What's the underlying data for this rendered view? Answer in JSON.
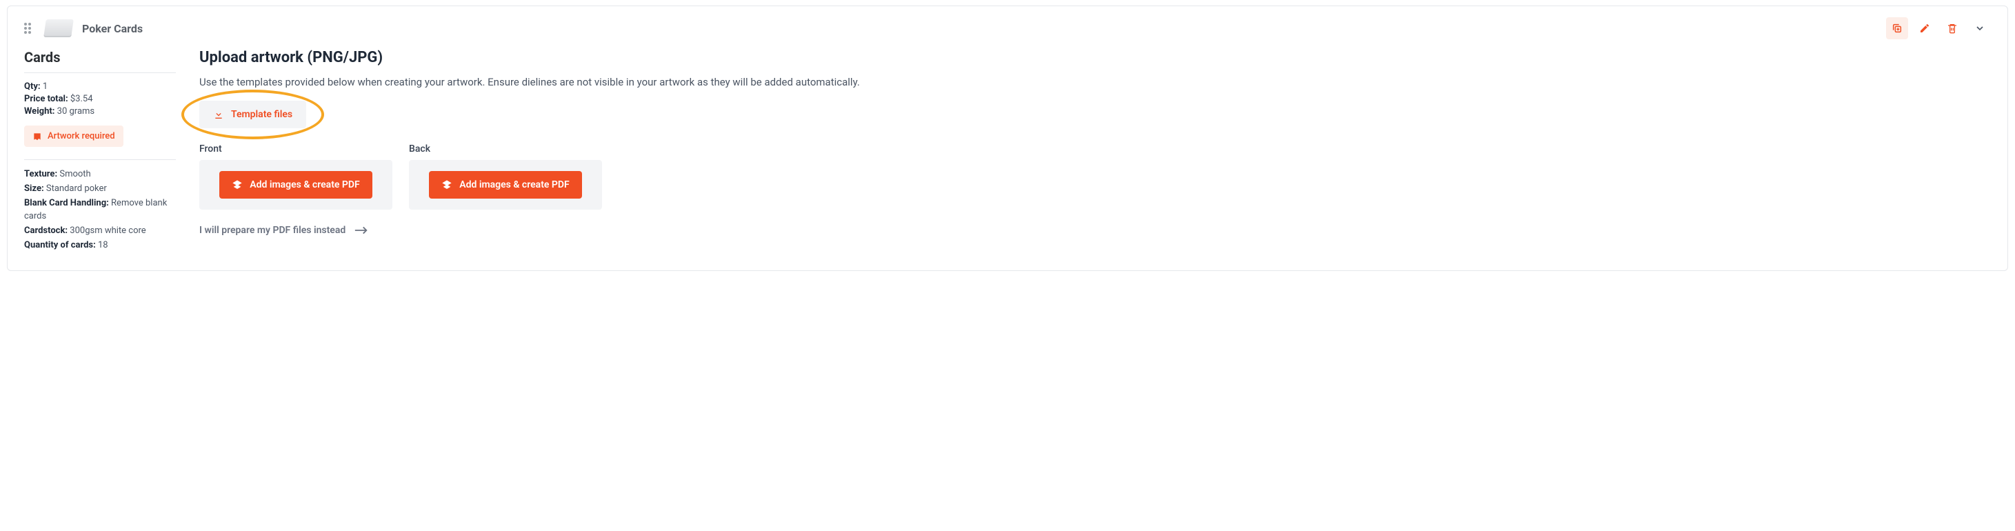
{
  "header": {
    "product_title": "Poker Cards"
  },
  "sidebar": {
    "heading": "Cards",
    "qty_label": "Qty:",
    "qty_value": "1",
    "price_label": "Price total:",
    "price_value": "$3.54",
    "weight_label": "Weight:",
    "weight_value": "30 grams",
    "status_label": "Artwork required",
    "specs": {
      "texture_label": "Texture:",
      "texture_value": "Smooth",
      "size_label": "Size:",
      "size_value": "Standard poker",
      "blank_label": "Blank Card Handling:",
      "blank_value": "Remove blank cards",
      "cardstock_label": "Cardstock:",
      "cardstock_value": "300gsm white core",
      "qtycards_label": "Quantity of cards:",
      "qtycards_value": "18"
    }
  },
  "main": {
    "heading": "Upload artwork (PNG/JPG)",
    "description": "Use the templates provided below when creating your artwork. Ensure dielines are not visible in your artwork as they will be added automatically.",
    "template_button": "Template files",
    "front_label": "Front",
    "back_label": "Back",
    "add_images_label": "Add images & create PDF",
    "alt_link": "I will prepare my PDF files instead"
  }
}
